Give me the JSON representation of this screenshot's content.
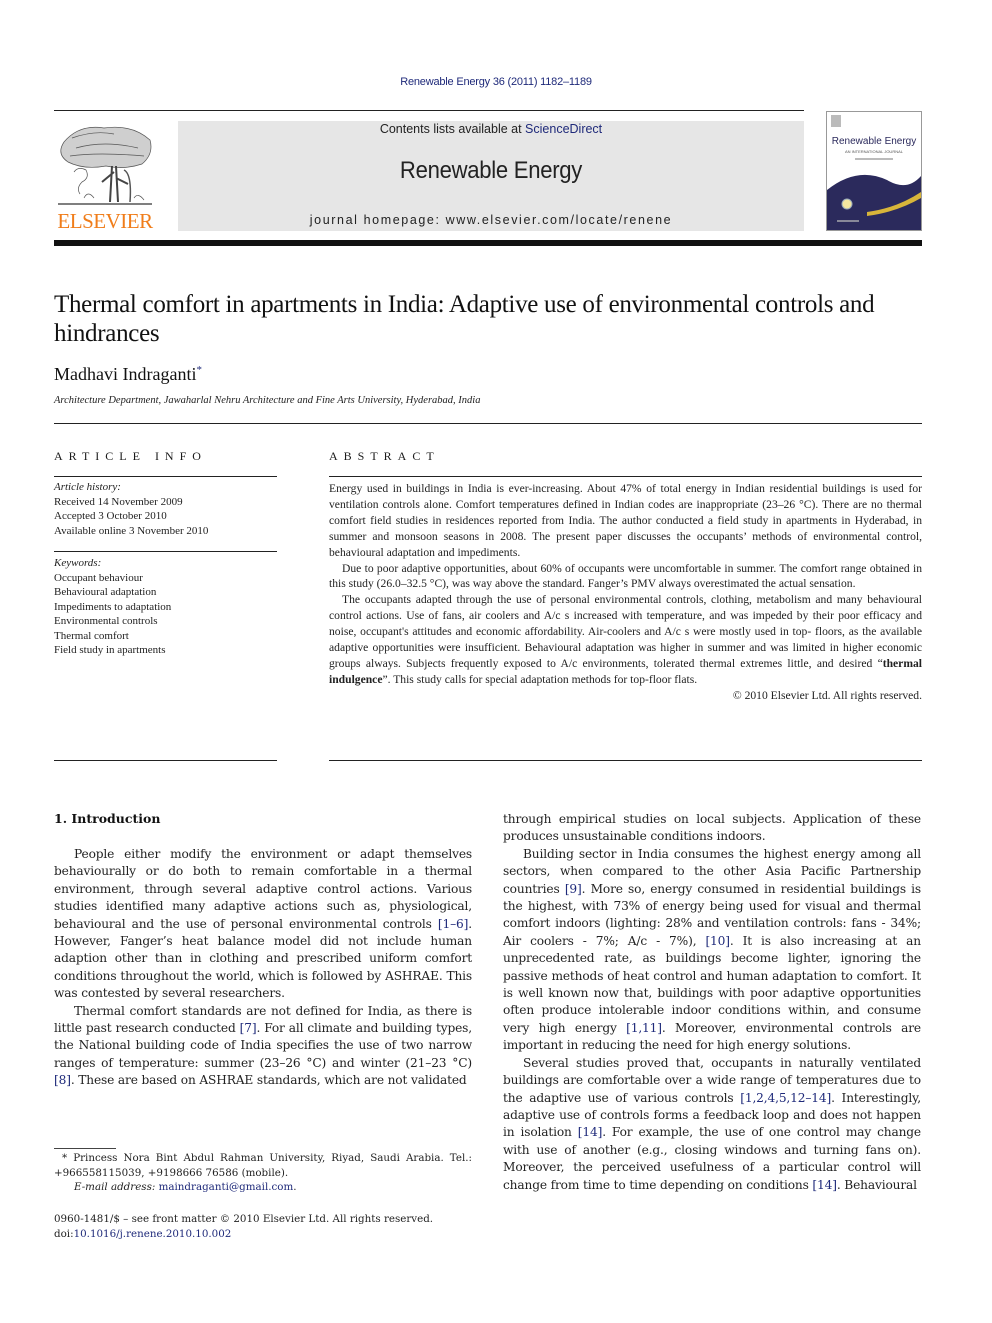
{
  "header": {
    "citation": "Renewable Energy 36 (2011) 1182–1189",
    "publisher_logo_text": "ELSEVIER",
    "contents_prefix": "Contents lists available at ",
    "contents_link": "ScienceDirect",
    "journal_title": "Renewable Energy",
    "homepage": "journal homepage: www.elsevier.com/locate/renene",
    "cover": {
      "title": "Renewable Energy",
      "subtitle": "AN INTERNATIONAL JOURNAL"
    },
    "colors": {
      "elsevier_orange": "#f07d1a",
      "link_blue": "#1f2a7a",
      "cover_navy": "#2b2a5c",
      "cover_gold": "#d8b53a",
      "banner_gray": "#e6e6e6"
    }
  },
  "article": {
    "title": "Thermal comfort in apartments in India: Adaptive use of environmental controls and hindrances",
    "author": "Madhavi Indraganti",
    "author_mark": "*",
    "affiliation": "Architecture Department, Jawaharlal Nehru Architecture and Fine Arts University, Hyderabad, India"
  },
  "article_info": {
    "heading": "ARTICLE INFO",
    "history_label": "Article history:",
    "history": [
      "Received 14 November 2009",
      "Accepted 3 October 2010",
      "Available online 3 November 2010"
    ],
    "keywords_label": "Keywords:",
    "keywords": [
      "Occupant behaviour",
      "Behavioural adaptation",
      "Impediments to adaptation",
      "Environmental controls",
      "Thermal comfort",
      "Field study in apartments"
    ]
  },
  "abstract": {
    "heading": "ABSTRACT",
    "p1": "Energy used in buildings in India is ever-increasing. About 47% of total energy in Indian residential buildings is used for ventilation controls alone. Comfort temperatures defined in Indian codes are inappropriate (23–26 °C). There are no thermal comfort field studies in residences reported from India. The author conducted a field study in apartments in Hyderabad, in summer and monsoon seasons in 2008. The present paper discusses the occupants’ methods of environmental control, behavioural adaptation and impediments.",
    "p2": "Due to poor adaptive opportunities, about 60% of occupants were uncomfortable in summer. The comfort range obtained in this study (26.0–32.5 °C), was way above the standard. Fanger’s PMV always overestimated the actual sensation.",
    "p3_pre": "The occupants adapted through the use of personal environmental controls, clothing, metabolism and many behavioural control actions. Use of fans, air coolers and A/c s increased with temperature, and was impeded by their poor efficacy and noise, occupant's attitudes and economic affordability. Air-coolers and A/c s were mostly used in top- floors, as the available adaptive opportunities were insufficient. Behavioural adaptation was higher in summer and was limited in higher economic groups always. Subjects frequently exposed to A/c environments, tolerated thermal extremes little, and desired “",
    "p3_bold": "thermal indulgence",
    "p3_post": "”. This study calls for special adaptation methods for top-floor flats.",
    "copyright": "© 2010 Elsevier Ltd. All rights reserved."
  },
  "body": {
    "section_heading": "1.  Introduction",
    "left": {
      "p1_pre": "People either modify the environment or adapt themselves behaviourally or do both to remain comfortable in a thermal environment, through several adaptive control actions. Various studies identified many adaptive actions such as, physiological, behavioural and the use of personal environmental controls ",
      "p1_ref1": "[1–6]",
      "p1_post": ". However, Fanger’s heat balance model did not include human adaption other than in clothing and prescribed uniform comfort conditions throughout the world, which is followed by ASHRAE. This was contested by several researchers.",
      "p2_pre": "Thermal comfort standards are not defined for India, as there is little past research conducted ",
      "p2_ref1": "[7]",
      "p2_mid": ". For all climate and building types, the National building code of India specifies the use of two narrow ranges of temperature: summer (23–26 °C) and winter (21–23 °C) ",
      "p2_ref2": "[8]",
      "p2_post": ". These are based on ASHRAE standards, which are not validated"
    },
    "right": {
      "p0": "through empirical studies on local subjects. Application of these produces unsustainable conditions indoors.",
      "p1_pre": "Building sector in India consumes the highest energy among all sectors, when compared to the other Asia Pacific Partnership countries ",
      "p1_ref1": "[9]",
      "p1_mid": ". More so, energy consumed in residential buildings is the highest, with 73% of energy being used for visual and thermal comfort indoors (lighting: 28% and ventilation controls: fans - 34%; Air coolers - 7%; A/c - 7%), ",
      "p1_ref2": "[10]",
      "p1_mid2": ". It is also increasing at an unprecedented rate, as buildings become lighter, ignoring the passive methods of heat control and human adaptation to comfort. It is well known now that, buildings with poor adaptive opportunities often produce intolerable indoor conditions within, and consume very high energy ",
      "p1_ref3": "[1,11]",
      "p1_post": ". Moreover, environmental controls are important in reducing the need for high energy solutions.",
      "p2_pre": "Several studies proved that, occupants in naturally ventilated buildings are comfortable over a wide range of temperatures due to the adaptive use of various controls ",
      "p2_ref1": "[1,2,4,5,12–14]",
      "p2_mid": ". Interestingly, adaptive use of controls forms a feedback loop and does not happen in isolation ",
      "p2_ref2": "[14]",
      "p2_mid2": ". For example, the use of one control may change with use of another (e.g., closing windows and turning fans on). Moreover, the perceived usefulness of a particular control will change from time to time depending on conditions ",
      "p2_ref3": "[14]",
      "p2_post": ". Behavioural"
    }
  },
  "footnote": {
    "text": "* Princess Nora Bint Abdul Rahman University, Riyad, Saudi Arabia. Tel.: +966558115039, +9198666 76586 (mobile).",
    "email_label": "E-mail address: ",
    "email": "maindraganti@gmail.com",
    "email_end": "."
  },
  "front_matter": {
    "issn_line": "0960-1481/$ – see front matter © 2010 Elsevier Ltd. All rights reserved.",
    "doi_label": "doi:",
    "doi": "10.1016/j.renene.2010.10.002"
  }
}
